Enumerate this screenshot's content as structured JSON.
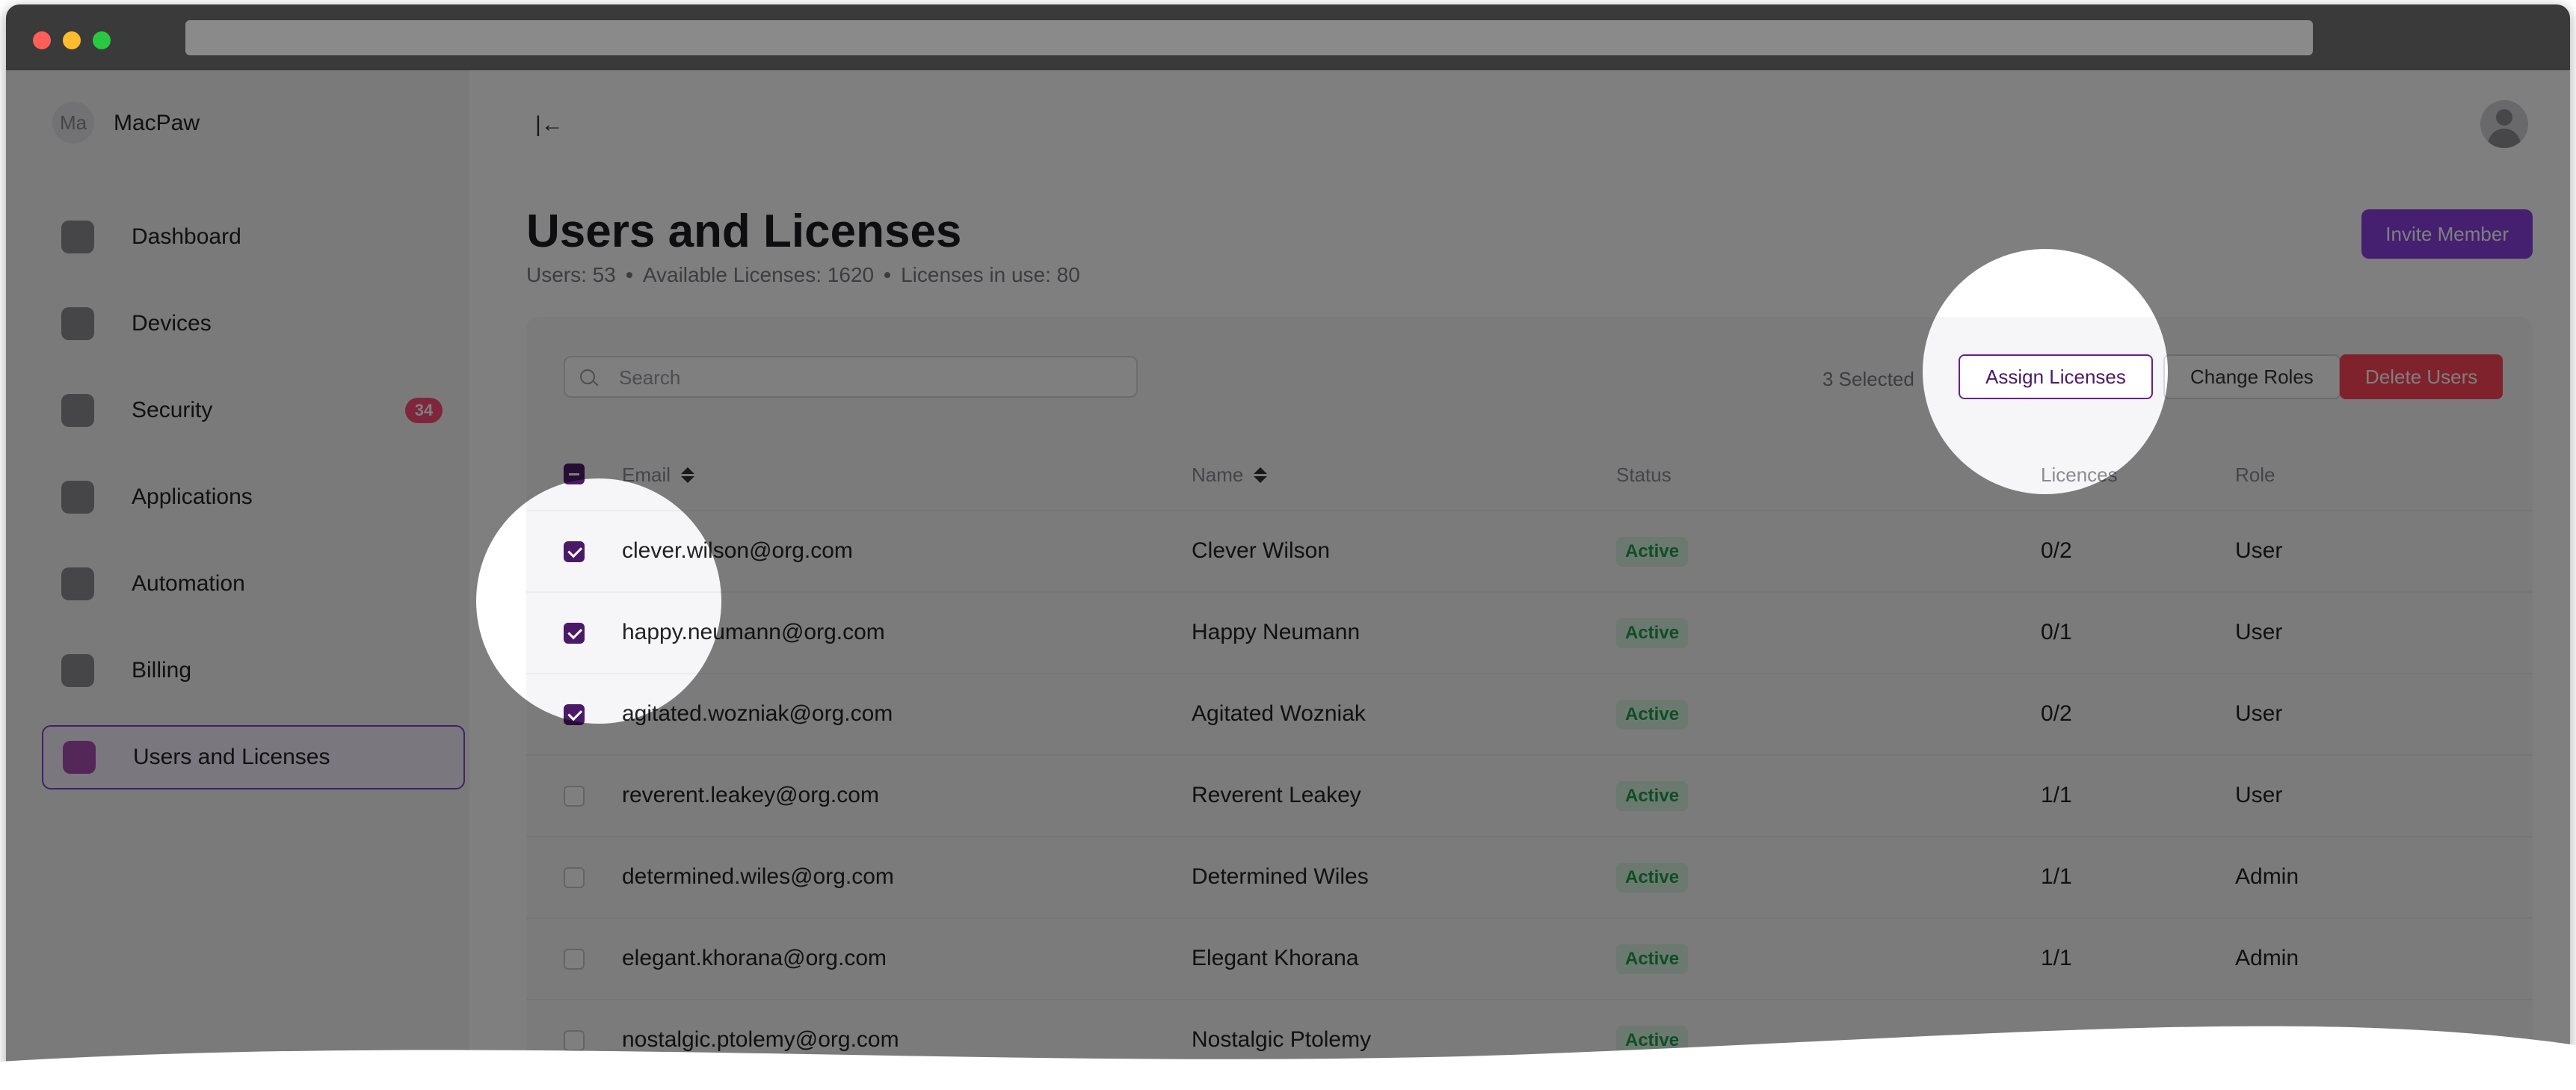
{
  "org": {
    "avatar_initials": "Ma",
    "name": "MacPaw"
  },
  "sidebar": {
    "items": [
      {
        "label": "Dashboard",
        "icon": "dashboard-icon"
      },
      {
        "label": "Devices",
        "icon": "devices-icon"
      },
      {
        "label": "Security",
        "icon": "shield-icon",
        "badge": "34"
      },
      {
        "label": "Applications",
        "icon": "applications-icon"
      },
      {
        "label": "Automation",
        "icon": "automation-icon"
      },
      {
        "label": "Billing",
        "icon": "billing-icon"
      },
      {
        "label": "Users and Licenses",
        "icon": "users-licenses-icon",
        "active": true
      }
    ]
  },
  "header": {
    "collapse_icon_glyph": "|←",
    "title": "Users and Licenses",
    "stats": [
      "Users: 53",
      "Available Licenses: 1620",
      "Licenses in use: 80"
    ],
    "invite_button": "Invite Member"
  },
  "toolbar": {
    "search_placeholder": "Search",
    "selected_count": "3 Selected",
    "assign_button": "Assign Licenses",
    "change_roles_button": "Change Roles",
    "delete_button": "Delete Users"
  },
  "table": {
    "columns": {
      "email": "Email",
      "name": "Name",
      "status": "Status",
      "licences": "Licences",
      "role": "Role"
    },
    "rows": [
      {
        "email": "clever.wilson@org.com",
        "name": "Clever Wilson",
        "status": "Active",
        "licences": "0/2",
        "role": "User",
        "checked": true
      },
      {
        "email": "happy.neumann@org.com",
        "name": "Happy Neumann",
        "status": "Active",
        "licences": "0/1",
        "role": "User",
        "checked": true
      },
      {
        "email": "agitated.wozniak@org.com",
        "name": "Agitated Wozniak",
        "status": "Active",
        "licences": "0/2",
        "role": "User",
        "checked": true
      },
      {
        "email": "reverent.leakey@org.com",
        "name": "Reverent Leakey",
        "status": "Active",
        "licences": "1/1",
        "role": "User",
        "checked": false
      },
      {
        "email": "determined.wiles@org.com",
        "name": "Determined Wiles",
        "status": "Active",
        "licences": "1/1",
        "role": "Admin",
        "checked": false
      },
      {
        "email": "elegant.khorana@org.com",
        "name": "Elegant Khorana",
        "status": "Active",
        "licences": "1/1",
        "role": "Admin",
        "checked": false
      },
      {
        "email": "nostalgic.ptolemy@org.com",
        "name": "Nostalgic Ptolemy",
        "status": "Active",
        "licences": "",
        "role": "",
        "checked": false
      }
    ]
  },
  "colors": {
    "accent": "#8b3fe0",
    "checkbox": "#4a1a68",
    "danger": "#ff4458",
    "active_badge_bg": "#d8f3e0",
    "active_badge_text": "#1c9c4a",
    "badge": "#ff4b7d"
  }
}
